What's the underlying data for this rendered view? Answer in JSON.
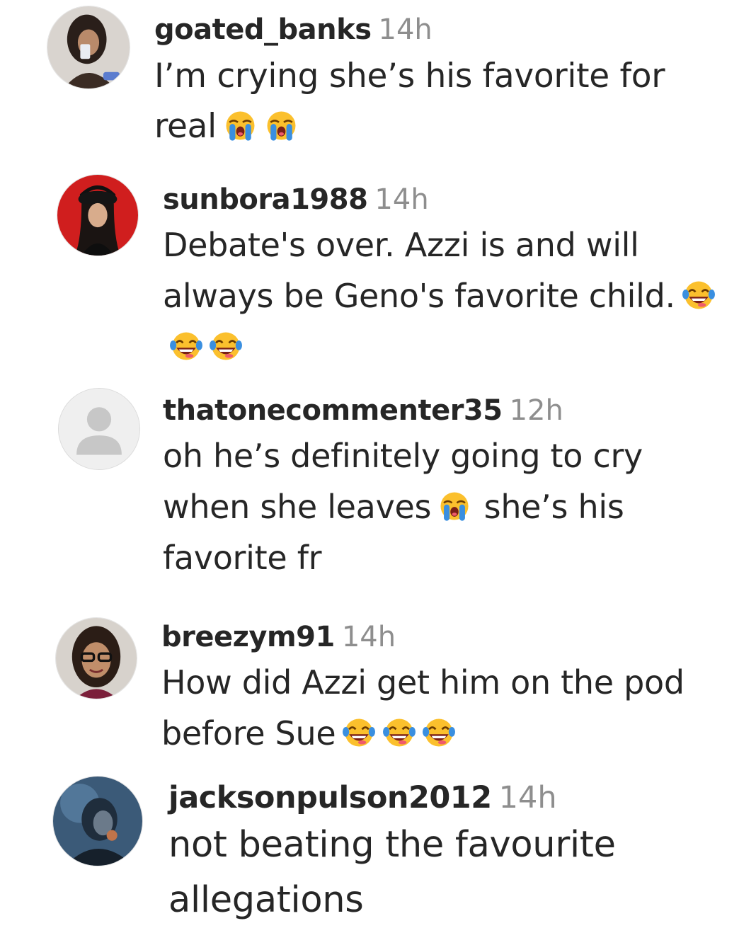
{
  "comments": [
    {
      "username": "goated_banks",
      "time": "14h",
      "text": "I’m crying she’s his favorite for real",
      "emojis": [
        "loudly-crying-face",
        "loudly-crying-face"
      ],
      "avatar": "profile-photo"
    },
    {
      "username": "sunbora1988",
      "time": "14h",
      "text": "Debate's over. Azzi is and will always be Geno's favorite child.",
      "emojis": [
        "face-with-tears-of-joy",
        "face-with-tears-of-joy",
        "face-with-tears-of-joy"
      ],
      "avatar": "profile-photo"
    },
    {
      "username": "thatonecommenter35",
      "time": "12h",
      "text_before_emoji": "oh he’s definitely going to cry when she leaves",
      "emojis": [
        "loudly-crying-face"
      ],
      "text_after_emoji": "she’s his favorite fr",
      "avatar": "default-avatar-icon"
    },
    {
      "username": "breezym91",
      "time": "14h",
      "text": "How did Azzi get him on the pod before Sue",
      "emojis": [
        "face-with-tears-of-joy",
        "face-with-tears-of-joy",
        "face-with-tears-of-joy"
      ],
      "avatar": "profile-photo"
    },
    {
      "username": "jacksonpulson2012",
      "time": "14h",
      "text": "not beating the favourite allegations",
      "emojis": [],
      "avatar": "profile-photo"
    }
  ],
  "colors": {
    "text": "#262626",
    "timestamp": "#8e8e8e",
    "emoji_face": "#fbc02d",
    "emoji_tear": "#3a8fe0"
  }
}
